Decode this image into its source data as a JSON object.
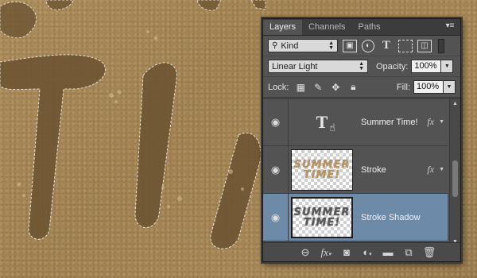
{
  "tabs": [
    {
      "label": "Layers",
      "active": true
    },
    {
      "label": "Channels",
      "active": false
    },
    {
      "label": "Paths",
      "active": false
    }
  ],
  "panel_menu_icon": "panel-menu-icon",
  "filter": {
    "kind_label": "Kind",
    "icons": [
      "pixel-filter-icon",
      "adjustment-filter-icon",
      "type-filter-icon",
      "shape-filter-icon",
      "smart-object-filter-icon"
    ]
  },
  "blend": {
    "mode": "Linear Light",
    "opacity_label": "Opacity:",
    "opacity_value": "100%"
  },
  "lock": {
    "label": "Lock:",
    "icons": [
      "lock-transparent-icon",
      "lock-image-icon",
      "lock-position-icon",
      "lock-all-icon"
    ],
    "fill_label": "Fill:",
    "fill_value": "100%"
  },
  "layers": [
    {
      "name": "Summer Time!",
      "type": "text",
      "thumb_char": "T",
      "fx": "fx",
      "selected": false
    },
    {
      "name": "Stroke",
      "type": "image",
      "thumb_text": "SUMMER TIME!",
      "fx": "fx",
      "selected": false
    },
    {
      "name": "Stroke Shadow",
      "type": "image",
      "thumb_text": "SUMMER TIME!",
      "fx": "",
      "selected": true
    }
  ],
  "bottom_icons": [
    "link-layers-icon",
    "fx-icon",
    "mask-icon",
    "adjustment-icon",
    "group-folder-icon",
    "new-layer-icon",
    "trash-icon"
  ],
  "colors": {
    "panel_bg": "#535353",
    "selection": "#6e8aa9",
    "sand": "#a8895a"
  }
}
